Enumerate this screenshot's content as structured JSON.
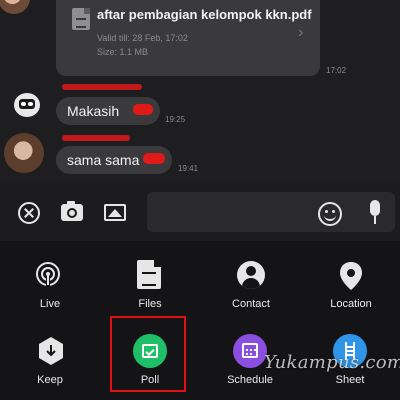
{
  "chat": {
    "file_message": {
      "name": "aftar pembagian kelompok kkn.pdf",
      "valid_till": "Valid till: 28 Feb, 17:02",
      "size": "Size: 1.1 MB",
      "time": "17:02"
    },
    "messages": [
      {
        "text": "Makasih",
        "time": "19:25"
      },
      {
        "text": "sama sama",
        "time": "19:41"
      }
    ]
  },
  "menu": {
    "items": [
      {
        "label": "Live",
        "icon": "live-icon"
      },
      {
        "label": "Files",
        "icon": "file-icon"
      },
      {
        "label": "Contact",
        "icon": "contact-icon"
      },
      {
        "label": "Location",
        "icon": "location-pin-icon"
      },
      {
        "label": "Keep",
        "icon": "keep-icon"
      },
      {
        "label": "Poll",
        "icon": "poll-icon"
      },
      {
        "label": "Schedule",
        "icon": "calendar-icon"
      },
      {
        "label": "Sheet",
        "icon": "sheet-icon"
      }
    ]
  },
  "watermark": "Yukampus.com",
  "colors": {
    "background": "#1e1e20",
    "bubble": "#3a3a3c",
    "menu_background": "#141416",
    "poll_green": "#1fbf69",
    "schedule_purple": "#8a4fe0",
    "sheet_blue": "#2f95e8",
    "highlight_red": "#e01010"
  }
}
